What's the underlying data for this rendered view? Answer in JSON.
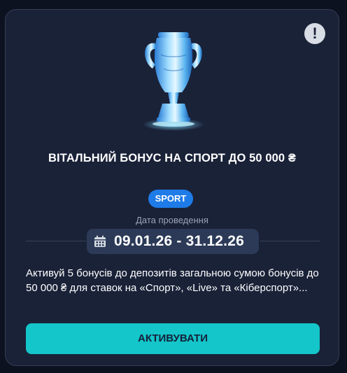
{
  "promo": {
    "title": "ВІТАЛЬНИЙ БОНУС НА СПОРТ ДО 50 000 ₴",
    "badge": "SPORT",
    "date_label": "Дата проведення",
    "date_range": "09.01.26 - 31.12.26",
    "description": "Активуй 5 бонусів до депозитів загальною сумою бонусів до 50 000 ₴ для ставок на «Спорт», «Live» та «Кіберспорт»...",
    "button_label": "АКТИВУВАТИ",
    "info_glyph": "!"
  },
  "icons": {
    "info": "info-icon",
    "calendar": "calendar-icon",
    "trophy": "trophy-icon"
  },
  "colors": {
    "background": "#0d1220",
    "card": "#1a2238",
    "badge": "#1e7be8",
    "date_box": "#2c3a58",
    "button": "#14c6c9"
  }
}
